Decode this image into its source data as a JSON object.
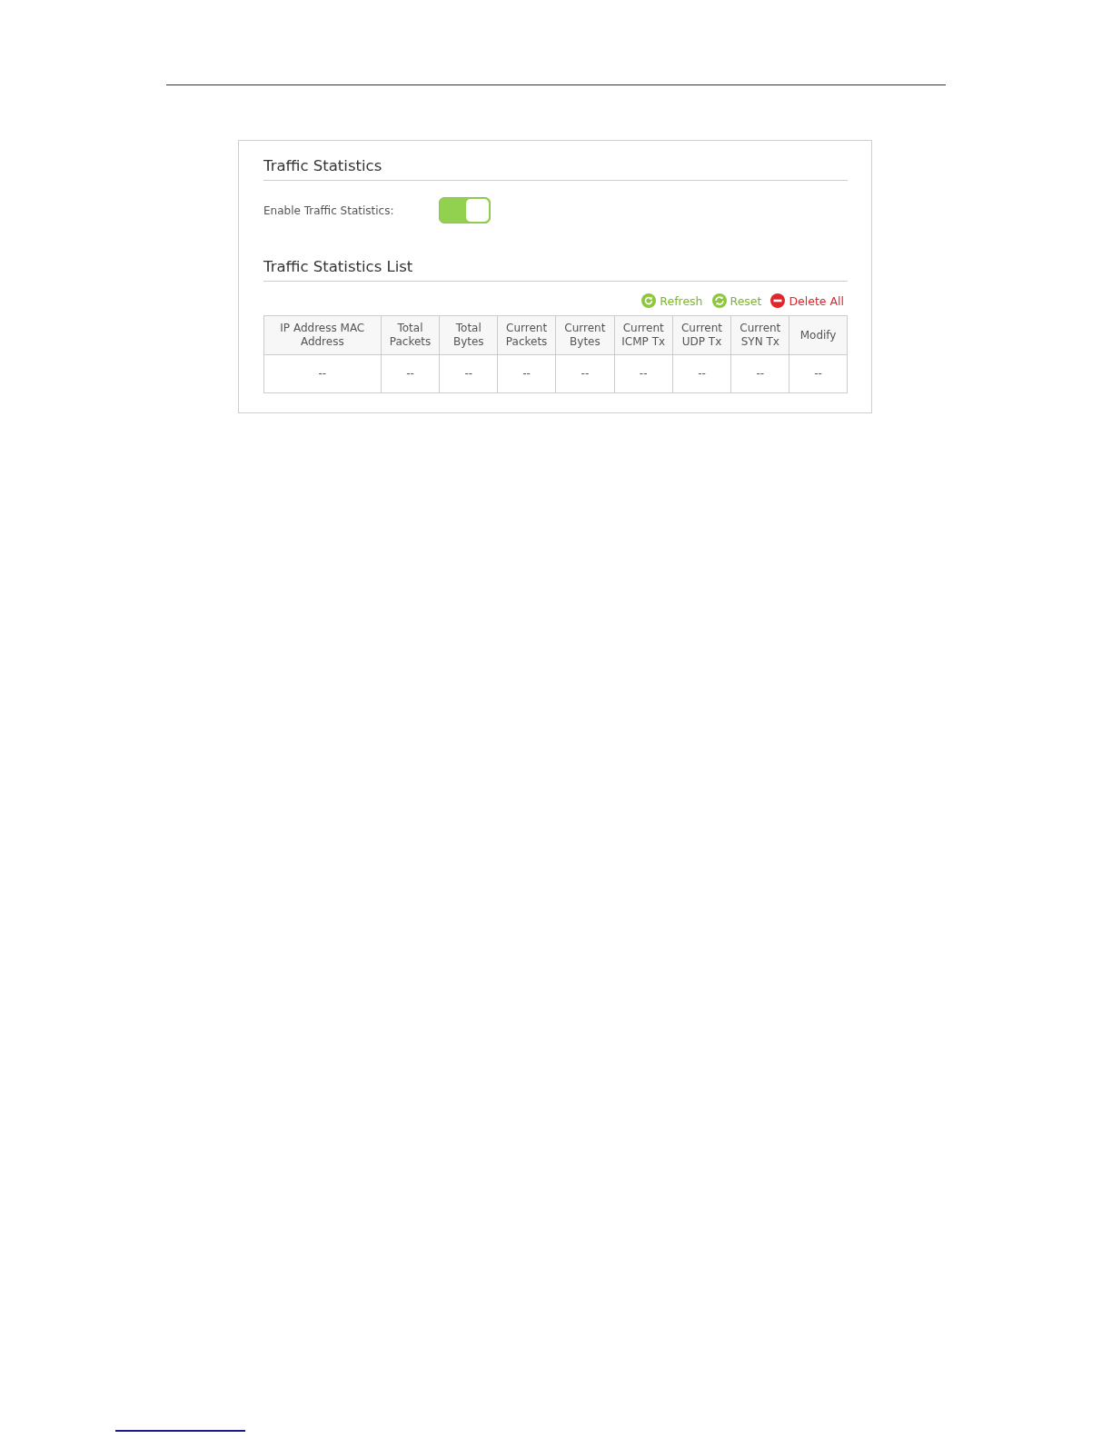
{
  "panel": {
    "title": "Traffic Statistics",
    "enable": {
      "label": "Enable Traffic Statistics:",
      "on": true
    }
  },
  "list": {
    "title": "Traffic Statistics List",
    "actions": [
      {
        "label": "Refresh",
        "kind": "refresh"
      },
      {
        "label": "Reset",
        "kind": "reset"
      },
      {
        "label": "Delete All",
        "kind": "delete"
      }
    ],
    "table": {
      "columns": [
        "IP Address MAC Address",
        "Total Packets",
        "Total Bytes",
        "Current Packets",
        "Current Bytes",
        "Current ICMP Tx",
        "Current UDP Tx",
        "Current SYN Tx",
        "Modify"
      ],
      "rows": [
        [
          "--",
          "--",
          "--",
          "--",
          "--",
          "--",
          "--",
          "--",
          "--"
        ]
      ]
    }
  }
}
